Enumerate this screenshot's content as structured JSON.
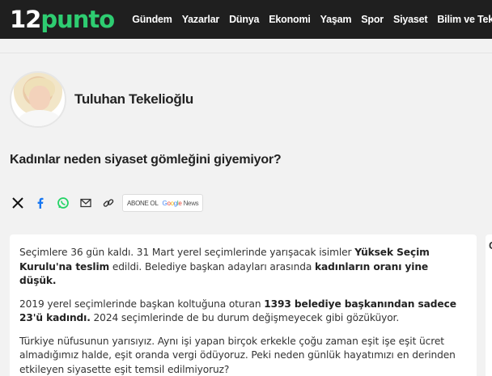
{
  "header": {
    "logo_number": "12",
    "logo_word": "punto",
    "nav": [
      "Gündem",
      "Yazarlar",
      "Dünya",
      "Ekonomi",
      "Yaşam",
      "Spor",
      "Siyaset",
      "Bilim ve Teknoloji"
    ]
  },
  "author": {
    "name": "Tuluhan Tekelioğlu"
  },
  "article": {
    "title": "Kadınlar neden siyaset gömleğini giyemiyor?",
    "paragraphs": [
      [
        {
          "t": "Seçimlere 36 gün kaldı. 31 Mart yerel seçimlerinde yarışacak isimler  ",
          "b": false
        },
        {
          "t": "Yüksek Seçim Kurulu'na teslim",
          "b": true
        },
        {
          "t": " edildi. Belediye başkan adayları arasında ",
          "b": false
        },
        {
          "t": "kadınların oranı yine düşük.",
          "b": true
        }
      ],
      [
        {
          "t": "2019 yerel seçimlerinde başkan koltuğuna oturan ",
          "b": false
        },
        {
          "t": "1393 belediye başkanından sadece 23'ü kadındı.",
          "b": true
        },
        {
          "t": " 2024 seçimlerinde de bu durum değişmeyecek gibi gözüküyor.",
          "b": false
        }
      ],
      [
        {
          "t": "Türkiye nüfusunun yarısıyız. Aynı işi yapan birçok erkekle çoğu zaman eşit işe eşit ücret almadığımız halde, eşit oranda vergi ödüyoruz. Peki neden günlük hayatımızı en derinden etkileyen siyasette eşit temsil edilmiyoruz?",
          "b": false
        }
      ]
    ]
  },
  "share": {
    "icons": [
      "x-icon",
      "facebook-icon",
      "whatsapp-icon",
      "mail-icon",
      "link-icon"
    ],
    "gnews_prefix": "ABONE OL",
    "gnews_letters": [
      "G",
      "o",
      "o",
      "g",
      "l",
      "e"
    ],
    "gnews_suffix": "News"
  },
  "side": {
    "peek_char": "G"
  },
  "colors": {
    "topbar": "#1f1f1f",
    "brand_green": "#2ecc71",
    "facebook": "#1877f2",
    "whatsapp": "#25d366"
  }
}
